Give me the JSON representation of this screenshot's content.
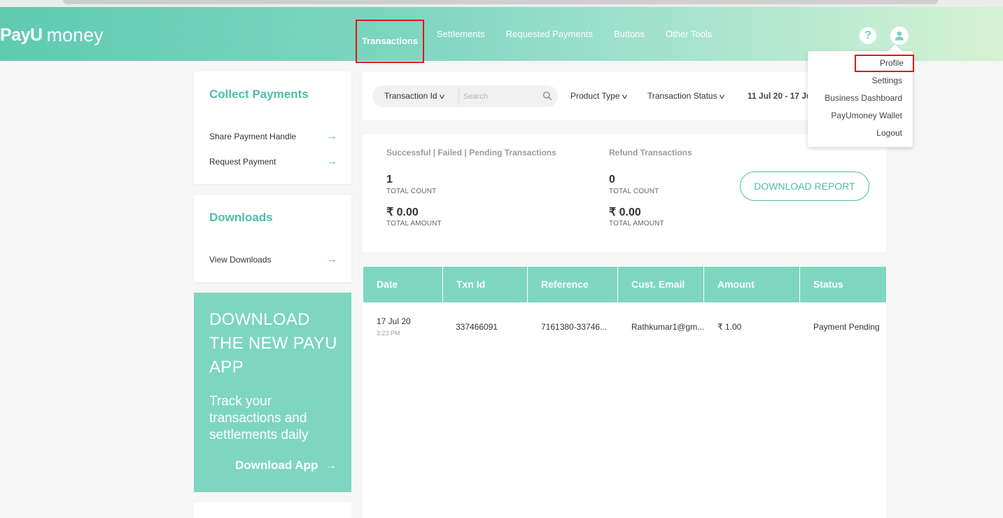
{
  "brand": {
    "logo_payu": "PayU",
    "logo_money": "money",
    "accent": "#4cbfa6",
    "header_color": "#7ed6c0"
  },
  "nav": {
    "items": [
      "Transactions",
      "Settlements",
      "Requested Payments",
      "Buttons",
      "Other Tools"
    ],
    "active": "Transactions"
  },
  "header_icons": {
    "help_icon": "question-mark",
    "help_label": "?",
    "user_icon": "user-avatar"
  },
  "profile_menu": {
    "items": [
      "Profile",
      "Settings",
      "Business Dashboard",
      "PayUmoney Wallet",
      "Logout"
    ],
    "highlighted": "Profile"
  },
  "collect": {
    "title": "Collect Payments",
    "links": [
      "Share Payment Handle",
      "Request Payment"
    ],
    "arrow": "→"
  },
  "downloads": {
    "title": "Downloads",
    "links": [
      "View Downloads"
    ]
  },
  "promo": {
    "headline": "DOWNLOAD THE NEW PAYU APP",
    "text": "Track your transactions and settlements daily",
    "button": "Download App"
  },
  "filters": {
    "search_by": "Transaction Id",
    "search_placeholder": "Search",
    "product_type": "Product Type",
    "transaction_status": "Transaction Status",
    "date_range": "11 Jul 20 - 17 Ju"
  },
  "summary": {
    "left_label": "Successful | Failed | Pending Transactions",
    "left_count": "1",
    "left_count_caption": "TOTAL COUNT",
    "left_amount": "₹ 0.00",
    "left_amount_caption": "TOTAL AMOUNT",
    "right_label": "Refund Transactions",
    "right_count": "0",
    "right_count_caption": "TOTAL COUNT",
    "right_amount": "₹ 0.00",
    "right_amount_caption": "TOTAL AMOUNT",
    "download_button": "DOWNLOAD REPORT"
  },
  "table": {
    "columns": [
      "Date",
      "Txn Id",
      "Reference",
      "Cust. Email",
      "Amount",
      "Status"
    ],
    "rows": [
      {
        "date": "17 Jul 20",
        "time": "3:23 PM",
        "txn_id": "337466091",
        "reference": "7161380-33746...",
        "email": "Rathkumar1@gm...",
        "amount": "₹ 1.00",
        "status": "Payment Pending"
      }
    ]
  }
}
